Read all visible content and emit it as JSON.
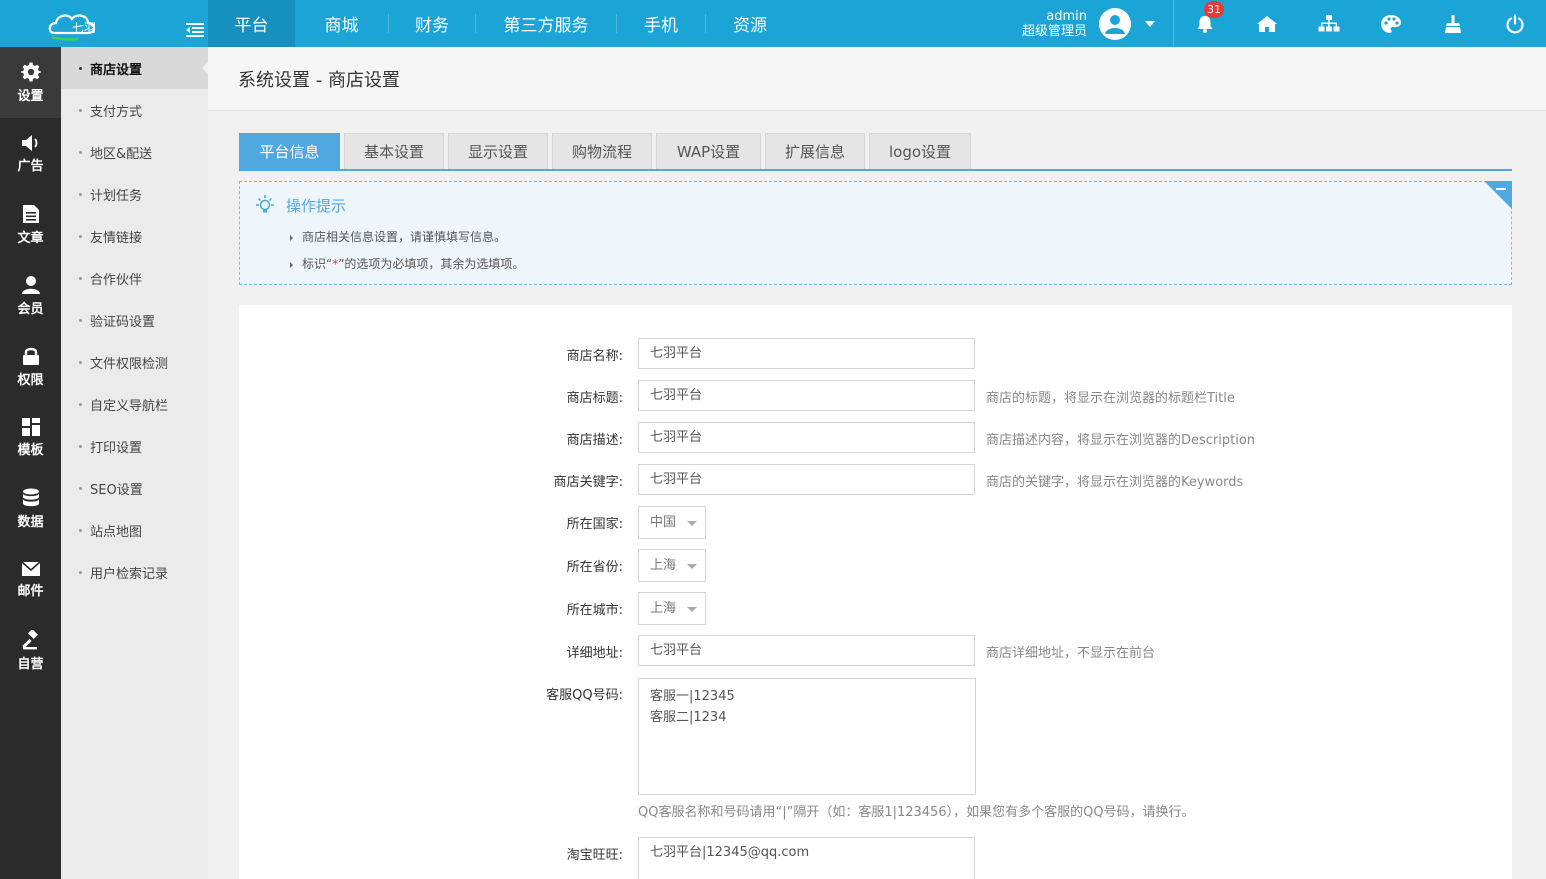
{
  "brand": {
    "logo_text": "七羽",
    "brand_color": "#1aa5d6"
  },
  "topnav": [
    {
      "label": "平台",
      "active": true
    },
    {
      "label": "商城",
      "active": false
    },
    {
      "label": "财务",
      "active": false
    },
    {
      "label": "第三方服务",
      "active": false
    },
    {
      "label": "手机",
      "active": false
    },
    {
      "label": "资源",
      "active": false
    }
  ],
  "user": {
    "name": "admin",
    "role": "超级管理员"
  },
  "notifications": {
    "count": "31"
  },
  "top_icons": [
    "bell-icon",
    "home-icon",
    "sitemap-icon",
    "palette-icon",
    "broom-icon",
    "power-icon"
  ],
  "iconbar": [
    {
      "label": "设置",
      "icon": "gear-icon",
      "active": true
    },
    {
      "label": "广告",
      "icon": "speaker-icon"
    },
    {
      "label": "文章",
      "icon": "document-icon"
    },
    {
      "label": "会员",
      "icon": "user-icon"
    },
    {
      "label": "权限",
      "icon": "lock-icon"
    },
    {
      "label": "模板",
      "icon": "grid-icon"
    },
    {
      "label": "数据",
      "icon": "database-icon"
    },
    {
      "label": "邮件",
      "icon": "envelope-icon"
    },
    {
      "label": "自营",
      "icon": "gavel-icon"
    }
  ],
  "submenu": [
    {
      "label": "商店设置",
      "active": true
    },
    {
      "label": "支付方式"
    },
    {
      "label": "地区&配送"
    },
    {
      "label": "计划任务"
    },
    {
      "label": "友情链接"
    },
    {
      "label": "合作伙伴"
    },
    {
      "label": "验证码设置"
    },
    {
      "label": "文件权限检测"
    },
    {
      "label": "自定义导航栏"
    },
    {
      "label": "打印设置"
    },
    {
      "label": "SEO设置"
    },
    {
      "label": "站点地图"
    },
    {
      "label": "用户检索记录"
    }
  ],
  "page": {
    "title": "系统设置 - 商店设置"
  },
  "tabs": [
    {
      "label": "平台信息",
      "active": true
    },
    {
      "label": "基本设置"
    },
    {
      "label": "显示设置"
    },
    {
      "label": "购物流程"
    },
    {
      "label": "WAP设置"
    },
    {
      "label": "扩展信息"
    },
    {
      "label": "logo设置"
    }
  ],
  "tips": {
    "title": "操作提示",
    "line1": "商店相关信息设置，请谨慎填写信息。",
    "line2_pre": "标识“",
    "line2_star": "*",
    "line2_post": "”的选项为必填项，其余为选填项。"
  },
  "form": {
    "shop_name": {
      "label": "商店名称:",
      "value": "七羽平台"
    },
    "shop_title": {
      "label": "商店标题:",
      "value": "七羽平台",
      "hint": "商店的标题，将显示在浏览器的标题栏Title"
    },
    "shop_desc": {
      "label": "商店描述:",
      "value": "七羽平台",
      "hint": "商店描述内容，将显示在浏览器的Description"
    },
    "shop_keywords": {
      "label": "商店关键字:",
      "value": "七羽平台",
      "hint": "商店的关键字，将显示在浏览器的Keywords"
    },
    "country": {
      "label": "所在国家:",
      "value": "中国"
    },
    "province": {
      "label": "所在省份:",
      "value": "上海"
    },
    "city": {
      "label": "所在城市:",
      "value": "上海"
    },
    "address": {
      "label": "详细地址:",
      "value": "七羽平台",
      "hint": "商店详细地址，不显示在前台"
    },
    "qq": {
      "label": "客服QQ号码:",
      "value": "客服一|12345\n客服二|1234",
      "hint": "QQ客服名称和号码请用“|”隔开（如：客服1|123456），如果您有多个客服的QQ号码，请换行。"
    },
    "wangwang": {
      "label": "淘宝旺旺:",
      "value": "七羽平台|12345@qq.com"
    }
  }
}
